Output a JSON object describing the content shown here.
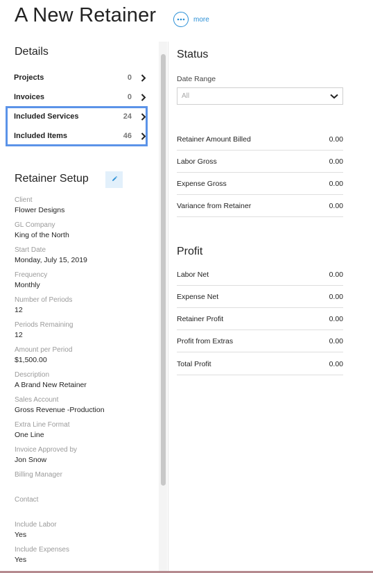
{
  "header": {
    "title": "A New Retainer",
    "more_label": "more"
  },
  "details": {
    "heading": "Details",
    "items": [
      {
        "label": "Projects",
        "count": "0"
      },
      {
        "label": "Invoices",
        "count": "0"
      },
      {
        "label": "Included Services",
        "count": "24"
      },
      {
        "label": "Included Items",
        "count": "46"
      }
    ]
  },
  "setup": {
    "heading": "Retainer Setup",
    "fields": [
      {
        "label": "Client",
        "value": "Flower Designs"
      },
      {
        "label": "GL Company",
        "value": "King of the North"
      },
      {
        "label": "Start Date",
        "value": "Monday, July 15, 2019"
      },
      {
        "label": "Frequency",
        "value": "Monthly"
      },
      {
        "label": "Number of Periods",
        "value": "12"
      },
      {
        "label": "Periods Remaining",
        "value": "12"
      },
      {
        "label": "Amount per Period",
        "value": "$1,500.00"
      },
      {
        "label": "Description",
        "value": "A Brand New Retainer"
      },
      {
        "label": "Sales Account",
        "value": "Gross Revenue -Production"
      },
      {
        "label": "Extra Line Format",
        "value": "One Line"
      },
      {
        "label": "Invoice Approved by",
        "value": "Jon Snow"
      },
      {
        "label": "Billing Manager",
        "value": ""
      },
      {
        "label": "Contact",
        "value": ""
      },
      {
        "label": "Include Labor",
        "value": "Yes"
      },
      {
        "label": "Include Expenses",
        "value": "Yes"
      }
    ]
  },
  "status": {
    "heading": "Status",
    "date_range_label": "Date Range",
    "date_range_value": "All",
    "metrics": [
      {
        "label": "Retainer Amount Billed",
        "value": "0.00"
      },
      {
        "label": "Labor Gross",
        "value": "0.00"
      },
      {
        "label": "Expense Gross",
        "value": "0.00"
      },
      {
        "label": "Variance from Retainer",
        "value": "0.00"
      }
    ]
  },
  "profit": {
    "heading": "Profit",
    "metrics": [
      {
        "label": "Labor Net",
        "value": "0.00"
      },
      {
        "label": "Expense Net",
        "value": "0.00"
      },
      {
        "label": "Retainer Profit",
        "value": "0.00"
      },
      {
        "label": "Profit from Extras",
        "value": "0.00"
      },
      {
        "label": "Total Profit",
        "value": "0.00"
      }
    ]
  },
  "colors": {
    "accent": "#2a8fd6",
    "highlight": "#5b93e8"
  }
}
